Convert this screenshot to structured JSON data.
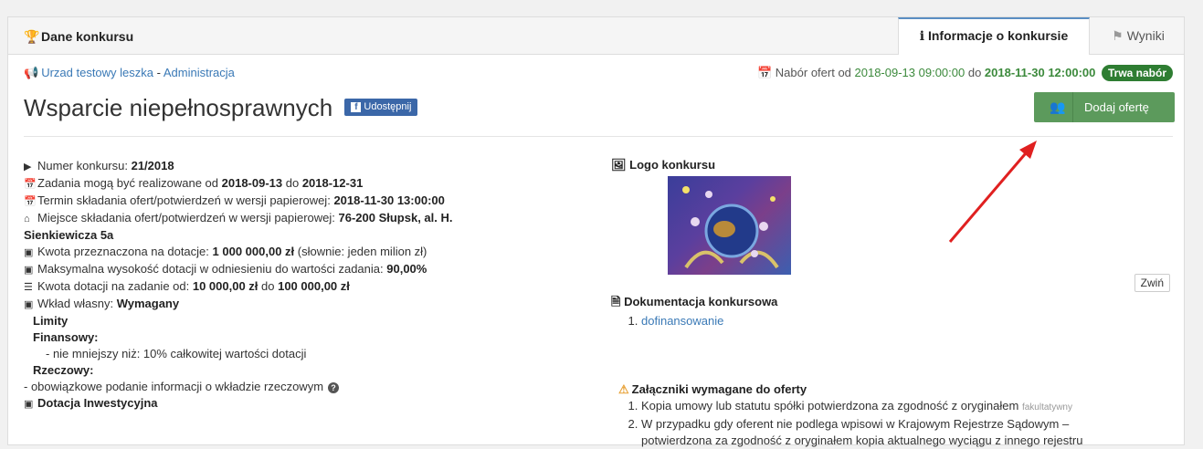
{
  "header": {
    "title": "Dane konkursu",
    "tab_info": "Informacje o konkursie",
    "tab_results": "Wyniki"
  },
  "org": {
    "name": "Urzad testowy leszka",
    "separator": " - ",
    "admin": "Administracja"
  },
  "nabor": {
    "prefix": "Nabór ofert od ",
    "from": "2018-09-13 09:00:00",
    "mid": " do ",
    "to": "2018-11-30 12:00:00",
    "badge": "Trwa nabór"
  },
  "contest_title": "Wsparcie niepełnosprawnych",
  "share_label": "Udostępnij",
  "add_offer_label": "Dodaj ofertę",
  "details": {
    "number_label": "Numer konkursu: ",
    "number_value": "21/2018",
    "tasks_label": "Zadania mogą być realizowane od ",
    "tasks_from": "2018-09-13",
    "tasks_mid": " do ",
    "tasks_to": "2018-12-31",
    "deadline_label": "Termin składania ofert/potwierdzeń w wersji papierowej: ",
    "deadline_value": "2018-11-30 13:00:00",
    "place_label": "Miejsce składania ofert/potwierdzeń w wersji papierowej: ",
    "place_value_1": "76-200 Słupsk, al. H.",
    "place_value_2": "Sienkiewicza 5a",
    "amount_label": "Kwota przeznaczona na dotacje: ",
    "amount_value": "1 000 000,00 zł",
    "amount_words": " (słownie: jeden milion zł)",
    "max_label": "Maksymalna wysokość dotacji w odniesieniu do wartości zadania: ",
    "max_value": "90,00%",
    "range_label": "Kwota dotacji na zadanie od: ",
    "range_from": "10 000,00 zł",
    "range_mid": " do ",
    "range_to": "100 000,00 zł",
    "own_label": "Wkład własny: ",
    "own_value": "Wymagany",
    "limits": "Limity",
    "financial": "Finansowy:",
    "financial_note": "- nie mniejszy niż: 10% całkowitej wartości dotacji",
    "material": "Rzeczowy:",
    "material_note": "- obowiązkowe podanie informacji o wkładzie rzeczowym",
    "investment": "Dotacja Inwestycyjna"
  },
  "right": {
    "logo_title": "Logo konkursu",
    "docs_title": "Dokumentacja konkursowa",
    "collapse_label": "Zwiń",
    "docs": [
      "dofinansowanie"
    ],
    "attach_title": "Załączniki wymagane do oferty",
    "attach_1": "Kopia umowy lub statutu spółki potwierdzona za zgodność z oryginałem",
    "attach_1_tag": "fakultatywny",
    "attach_2a": "W przypadku gdy oferent nie podlega wpisowi w Krajowym Rejestrze Sądowym –",
    "attach_2b": "potwierdzona za zgodność z oryginałem kopia aktualnego wyciągu z innego rejestru"
  },
  "colors": {
    "accent": "#3a79b6",
    "success": "#5c9a5c",
    "badge": "#2e7d32",
    "arrow": "#e02020"
  },
  "icons": [
    "trophy-icon",
    "info-icon",
    "flag-icon",
    "bullhorn-icon",
    "calendar-icon",
    "users-icon",
    "home-icon",
    "money-icon",
    "sliders-icon",
    "question-icon",
    "image-icon",
    "file-icon",
    "warning-icon",
    "facebook-icon",
    "play-icon"
  ]
}
